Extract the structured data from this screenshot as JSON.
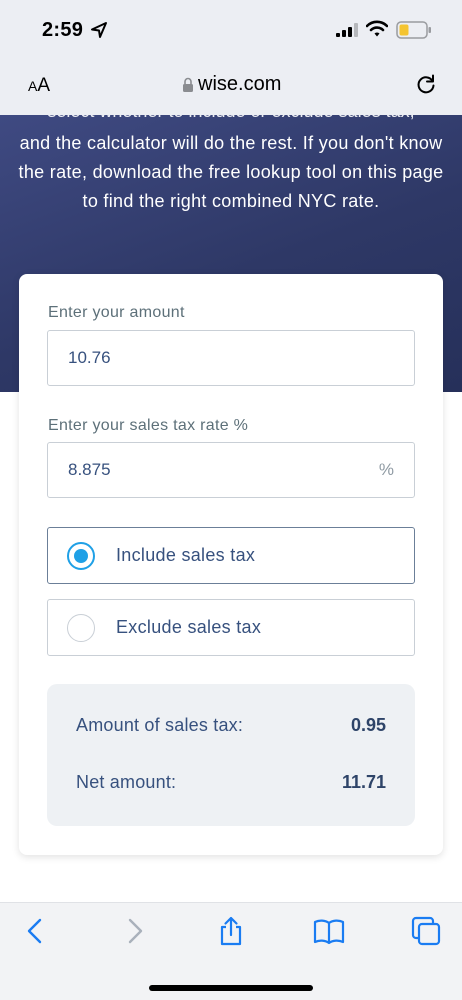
{
  "status_bar": {
    "time": "2:59"
  },
  "browser": {
    "aa_label_small": "A",
    "aa_label_large": "A",
    "url": "wise.com"
  },
  "hero": {
    "cut_line": "select whether to include or exclude sales tax,",
    "text": "and the calculator will do the rest. If you don't know the rate, download the free lookup tool on this page to find the right combined NYC rate."
  },
  "form": {
    "amount_label": "Enter your amount",
    "amount_value": "10.76",
    "rate_label": "Enter your sales tax rate %",
    "rate_value": "8.875",
    "rate_suffix": "%",
    "options": [
      {
        "label": "Include sales tax",
        "selected": true
      },
      {
        "label": "Exclude sales tax",
        "selected": false
      }
    ]
  },
  "results": {
    "sales_tax_label": "Amount of sales tax:",
    "sales_tax_value": "0.95",
    "net_label": "Net amount:",
    "net_value": "11.71"
  },
  "colors": {
    "accent": "#1fa0e6",
    "hero_bg": "#2e3866",
    "text": "#37517e",
    "toolbar_icon": "#1a7cf2"
  }
}
